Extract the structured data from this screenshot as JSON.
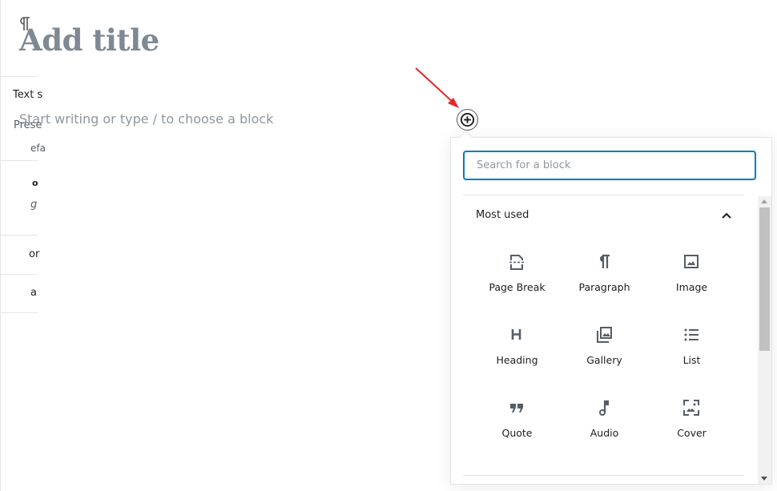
{
  "editor": {
    "title_placeholder": "Add title",
    "body_placeholder": "Start writing or type / to choose a block"
  },
  "sidebar": {
    "block_icon": "paragraph-icon",
    "texts": [
      "Text s",
      "Prese",
      "efa",
      "o",
      "g",
      "or",
      "a"
    ]
  },
  "inserter": {
    "add_block_icon": "plus-circle-icon",
    "search_placeholder": "Search for a block",
    "section_title": "Most used",
    "section_toggle_icon": "chevron-up-icon",
    "blocks": [
      {
        "label": "Page Break",
        "icon": "page-break-icon"
      },
      {
        "label": "Paragraph",
        "icon": "paragraph-icon"
      },
      {
        "label": "Image",
        "icon": "image-icon"
      },
      {
        "label": "Heading",
        "icon": "heading-icon"
      },
      {
        "label": "Gallery",
        "icon": "gallery-icon"
      },
      {
        "label": "List",
        "icon": "list-icon"
      },
      {
        "label": "Quote",
        "icon": "quote-icon"
      },
      {
        "label": "Audio",
        "icon": "audio-icon"
      },
      {
        "label": "Cover",
        "icon": "cover-icon"
      }
    ]
  },
  "colors": {
    "accent": "#007cba",
    "annotation_arrow": "#e8262a",
    "icon": "#555d66"
  }
}
